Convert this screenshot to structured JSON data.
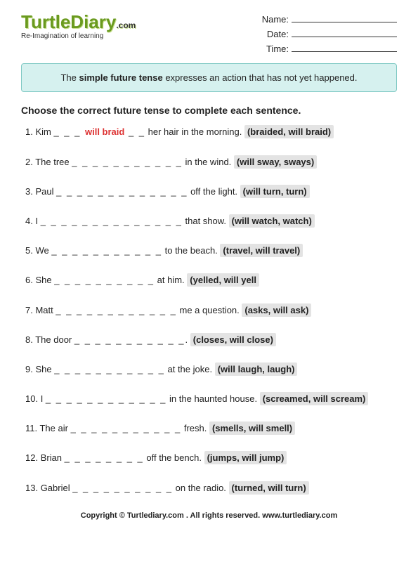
{
  "logo": {
    "text": "TurtleDiary",
    "dotcom": ".com",
    "tagline": "Re-Imagination of learning"
  },
  "info": {
    "name_label": "Name:",
    "date_label": "Date:",
    "time_label": "Time:"
  },
  "explain": {
    "pre": "The ",
    "bold": "simple future tense",
    "post": " expresses an action that has not yet happened."
  },
  "instructions": "Choose the correct future tense to complete each sentence.",
  "questions": [
    {
      "num": "1.",
      "pre": "Kim ",
      "blank": "_ _ _ ",
      "answer": "will braid",
      "blank2": " _ _",
      "post": " her hair in the morning.  ",
      "choices": "(braided, will braid)"
    },
    {
      "num": "2.",
      "pre": "The tree ",
      "blank": "_ _ _ _ _ _ _ _ _ _ _",
      "answer": "",
      "blank2": "",
      "post": " in the wind.  ",
      "choices": "(will sway, sways)"
    },
    {
      "num": "3.",
      "pre": "Paul ",
      "blank": "_ _ _ _ _ _ _ _ _ _ _ _ _",
      "answer": "",
      "blank2": "",
      "post": " off the light.  ",
      "choices": "(will turn, turn)"
    },
    {
      "num": "4.",
      "pre": "I ",
      "blank": "_ _ _ _ _ _ _ _ _ _ _ _ _ _",
      "answer": "",
      "blank2": "",
      "post": " that show.  ",
      "choices": "(will watch, watch)"
    },
    {
      "num": "5.",
      "pre": "We ",
      "blank": "_ _ _ _ _ _ _ _ _ _ _",
      "answer": "",
      "blank2": "",
      "post": " to the beach.  ",
      "choices": "(travel, will travel)"
    },
    {
      "num": "6.",
      "pre": "She ",
      "blank": "_ _ _ _ _ _ _ _ _ _",
      "answer": "",
      "blank2": "",
      "post": " at him.  ",
      "choices": "(yelled, will yell"
    },
    {
      "num": "7.",
      "pre": "Matt ",
      "blank": "_ _ _ _ _ _ _ _ _ _ _ _",
      "answer": "",
      "blank2": "",
      "post": " me a question.  ",
      "choices": "(asks, will ask)"
    },
    {
      "num": "8.",
      "pre": "The door ",
      "blank": "_ _ _ _ _ _ _ _ _ _ _",
      "answer": "",
      "blank2": "",
      "post": ".  ",
      "choices": "(closes, will close)"
    },
    {
      "num": "9.",
      "pre": "She ",
      "blank": "_ _ _ _ _ _ _ _ _ _ _",
      "answer": "",
      "blank2": "",
      "post": " at the joke.  ",
      "choices": "(will laugh, laugh)"
    },
    {
      "num": "10.",
      "pre": "I ",
      "blank": "_ _ _ _ _ _ _ _ _ _ _ _",
      "answer": "",
      "blank2": "",
      "post": " in the haunted house.  ",
      "choices": "(screamed, will scream)"
    },
    {
      "num": "11.",
      "pre": "The air ",
      "blank": "_ _ _ _ _ _ _ _ _ _ _",
      "answer": "",
      "blank2": "",
      "post": " fresh.  ",
      "choices": "(smells, will smell)"
    },
    {
      "num": "12.",
      "pre": "Brian ",
      "blank": "_ _ _ _ _ _ _ _",
      "answer": "",
      "blank2": "",
      "post": " off the bench.  ",
      "choices": "(jumps, will jump)"
    },
    {
      "num": "13.",
      "pre": "Gabriel ",
      "blank": "_ _ _ _ _ _ _ _ _ _",
      "answer": "",
      "blank2": "",
      "post": " on the radio.  ",
      "choices": "(turned, will turn)"
    }
  ],
  "footer": "Copyright © Turtlediary.com . All rights reserved. www.turtlediary.com"
}
